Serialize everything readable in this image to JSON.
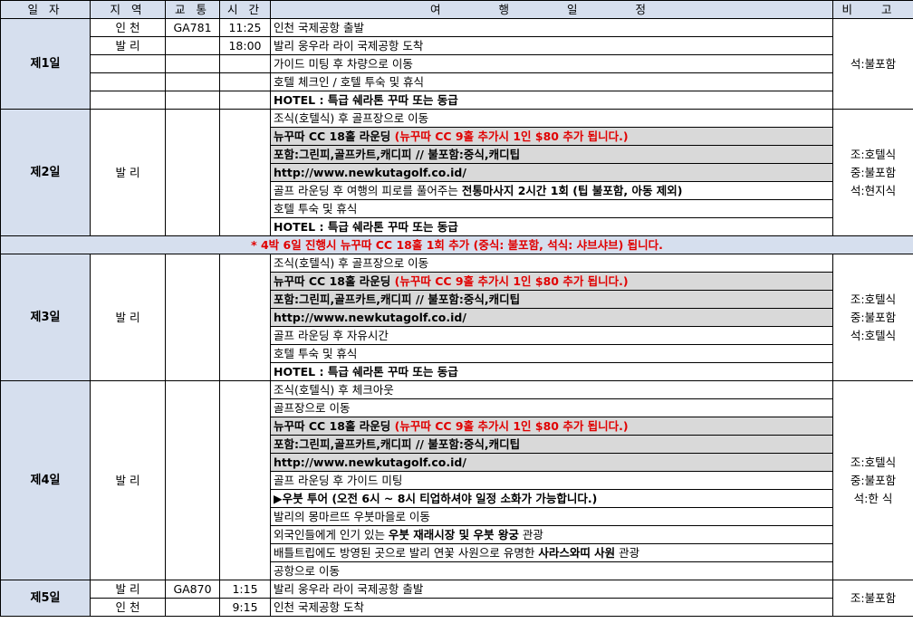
{
  "headers": {
    "date": "일 자",
    "region": "지 역",
    "transport": "교 통",
    "time": "시 간",
    "schedule": "여 행 일 정",
    "note": "비 고"
  },
  "days": [
    {
      "label": "제1일",
      "notes": [
        "석:불포함"
      ],
      "rows": [
        {
          "region": "인 천",
          "transport": "GA781",
          "time": "11:25",
          "parts": [
            {
              "t": "인천 국제공항 출발"
            }
          ]
        },
        {
          "region": "발 리",
          "transport": "",
          "time": "18:00",
          "parts": [
            {
              "t": "발리 웅우라 라이 국제공항 도착"
            }
          ]
        },
        {
          "region": "",
          "transport": "",
          "time": "",
          "parts": [
            {
              "t": "가이드 미팅 후 차량으로 이동"
            }
          ]
        },
        {
          "region": "",
          "transport": "",
          "time": "",
          "parts": [
            {
              "t": "호텔 체크인 / 호텔 투숙 및 휴식"
            }
          ]
        },
        {
          "region": "",
          "transport": "",
          "time": "",
          "parts": [
            {
              "t": "HOTEL : 특급 쉐라톤 꾸따 또는 동급",
              "s": "b"
            }
          ]
        }
      ]
    },
    {
      "label": "제2일",
      "region": "발 리",
      "notes": [
        "조:호텔식",
        "중:불포함",
        "석:현지식"
      ],
      "rows": [
        {
          "parts": [
            {
              "t": "조식(호텔식) 후 골프장으로 이동"
            }
          ]
        },
        {
          "gray": true,
          "parts": [
            {
              "t": "뉴꾸따 CC 18홀 라운딩 ",
              "s": "b"
            },
            {
              "t": "(뉴꾸따 CC 9홀 추가시 1인 $80 추가 됩니다.)",
              "s": "red"
            }
          ]
        },
        {
          "gray": true,
          "parts": [
            {
              "t": "포함:그린피,골프카트,캐디피 // 불포함:중식,캐디팁",
              "s": "b"
            }
          ]
        },
        {
          "gray": true,
          "parts": [
            {
              "t": "http://www.newkutagolf.co.id/",
              "s": "b"
            }
          ]
        },
        {
          "parts": [
            {
              "t": "골프 라운딩 후 여행의 피로를 풀어주는 "
            },
            {
              "t": "전통마사지 2시간 1회 (팁 불포함, 아동 제외)",
              "s": "b"
            }
          ]
        },
        {
          "parts": [
            {
              "t": "호텔 투숙 및 휴식"
            }
          ]
        },
        {
          "parts": [
            {
              "t": "HOTEL : 특급 쉐라톤 꾸따 또는 동급",
              "s": "b"
            }
          ]
        }
      ]
    },
    {
      "label": "제3일",
      "region": "발 리",
      "notes": [
        "조:호텔식",
        "중:불포함",
        "석:호텔식"
      ],
      "rows": [
        {
          "parts": [
            {
              "t": "조식(호텔식) 후 골프장으로 이동"
            }
          ]
        },
        {
          "gray": true,
          "parts": [
            {
              "t": "뉴꾸따 CC 18홀 라운딩 ",
              "s": "b"
            },
            {
              "t": "(뉴꾸따 CC 9홀 추가시 1인 $80 추가 됩니다.)",
              "s": "red"
            }
          ]
        },
        {
          "gray": true,
          "parts": [
            {
              "t": "포함:그린피,골프카트,캐디피 // 불포함:중식,캐디팁",
              "s": "b"
            }
          ]
        },
        {
          "gray": true,
          "parts": [
            {
              "t": "http://www.newkutagolf.co.id/",
              "s": "b"
            }
          ]
        },
        {
          "parts": [
            {
              "t": "골프 라운딩 후 자유시간"
            }
          ]
        },
        {
          "parts": [
            {
              "t": "호텔 투숙 및 휴식"
            }
          ]
        },
        {
          "parts": [
            {
              "t": "HOTEL : 특급 쉐라톤 꾸따 또는 동급",
              "s": "b"
            }
          ]
        }
      ]
    },
    {
      "label": "제4일",
      "region": "발 리",
      "notes": [
        "조:호텔식",
        "중:불포함",
        "석:한  식"
      ],
      "rows": [
        {
          "parts": [
            {
              "t": "조식(호텔식) 후 체크아웃"
            }
          ]
        },
        {
          "parts": [
            {
              "t": "골프장으로 이동"
            }
          ]
        },
        {
          "gray": true,
          "parts": [
            {
              "t": "뉴꾸따 CC 18홀 라운딩 ",
              "s": "b"
            },
            {
              "t": "(뉴꾸따 CC 9홀 추가시 1인 $80 추가 됩니다.)",
              "s": "red"
            }
          ]
        },
        {
          "gray": true,
          "parts": [
            {
              "t": "포함:그린피,골프카트,캐디피 // 불포함:중식,캐디팁",
              "s": "b"
            }
          ]
        },
        {
          "gray": true,
          "parts": [
            {
              "t": "http://www.newkutagolf.co.id/",
              "s": "b"
            }
          ]
        },
        {
          "parts": [
            {
              "t": "골프 라운딩 후 가이드 미팅"
            }
          ]
        },
        {
          "parts": [
            {
              "t": "▶우붓 투어 (오전 6시 ~ 8시 티업하셔야 일정 소화가 가능합니다.)",
              "s": "b"
            }
          ]
        },
        {
          "parts": [
            {
              "t": "발리의 몽마르뜨 우붓마을로 이동"
            }
          ]
        },
        {
          "parts": [
            {
              "t": "외국인들에게 인기 있는 "
            },
            {
              "t": "우붓 재래시장 및 우붓 왕궁",
              "s": "b"
            },
            {
              "t": " 관광"
            }
          ]
        },
        {
          "parts": [
            {
              "t": "배틀트립에도 방영된 곳으로 발리 연꽃 사원으로 유명한 "
            },
            {
              "t": "사라스와띠 사원",
              "s": "b"
            },
            {
              "t": " 관광"
            }
          ]
        },
        {
          "parts": [
            {
              "t": "공항으로 이동"
            }
          ]
        }
      ]
    },
    {
      "label": "제5일",
      "notes": [
        "조:불포함"
      ],
      "rows": [
        {
          "region": "발 리",
          "transport": "GA870",
          "time": "1:15",
          "parts": [
            {
              "t": "발리 웅우라 라이 국제공항 출발"
            }
          ]
        },
        {
          "region": "인 천",
          "transport": "",
          "time": "9:15",
          "parts": [
            {
              "t": "인천 국제공항  도착"
            }
          ]
        }
      ]
    }
  ],
  "banner": "* 4박 6일 진행시 뉴꾸따 CC 18홀 1회 추가 (중식: 불포함, 석식: 샤브샤브) 됩니다.",
  "colors": {
    "header_bg": "#d6dfee",
    "highlight_bg": "#d9d9d9",
    "accent_red": "#e00000"
  }
}
